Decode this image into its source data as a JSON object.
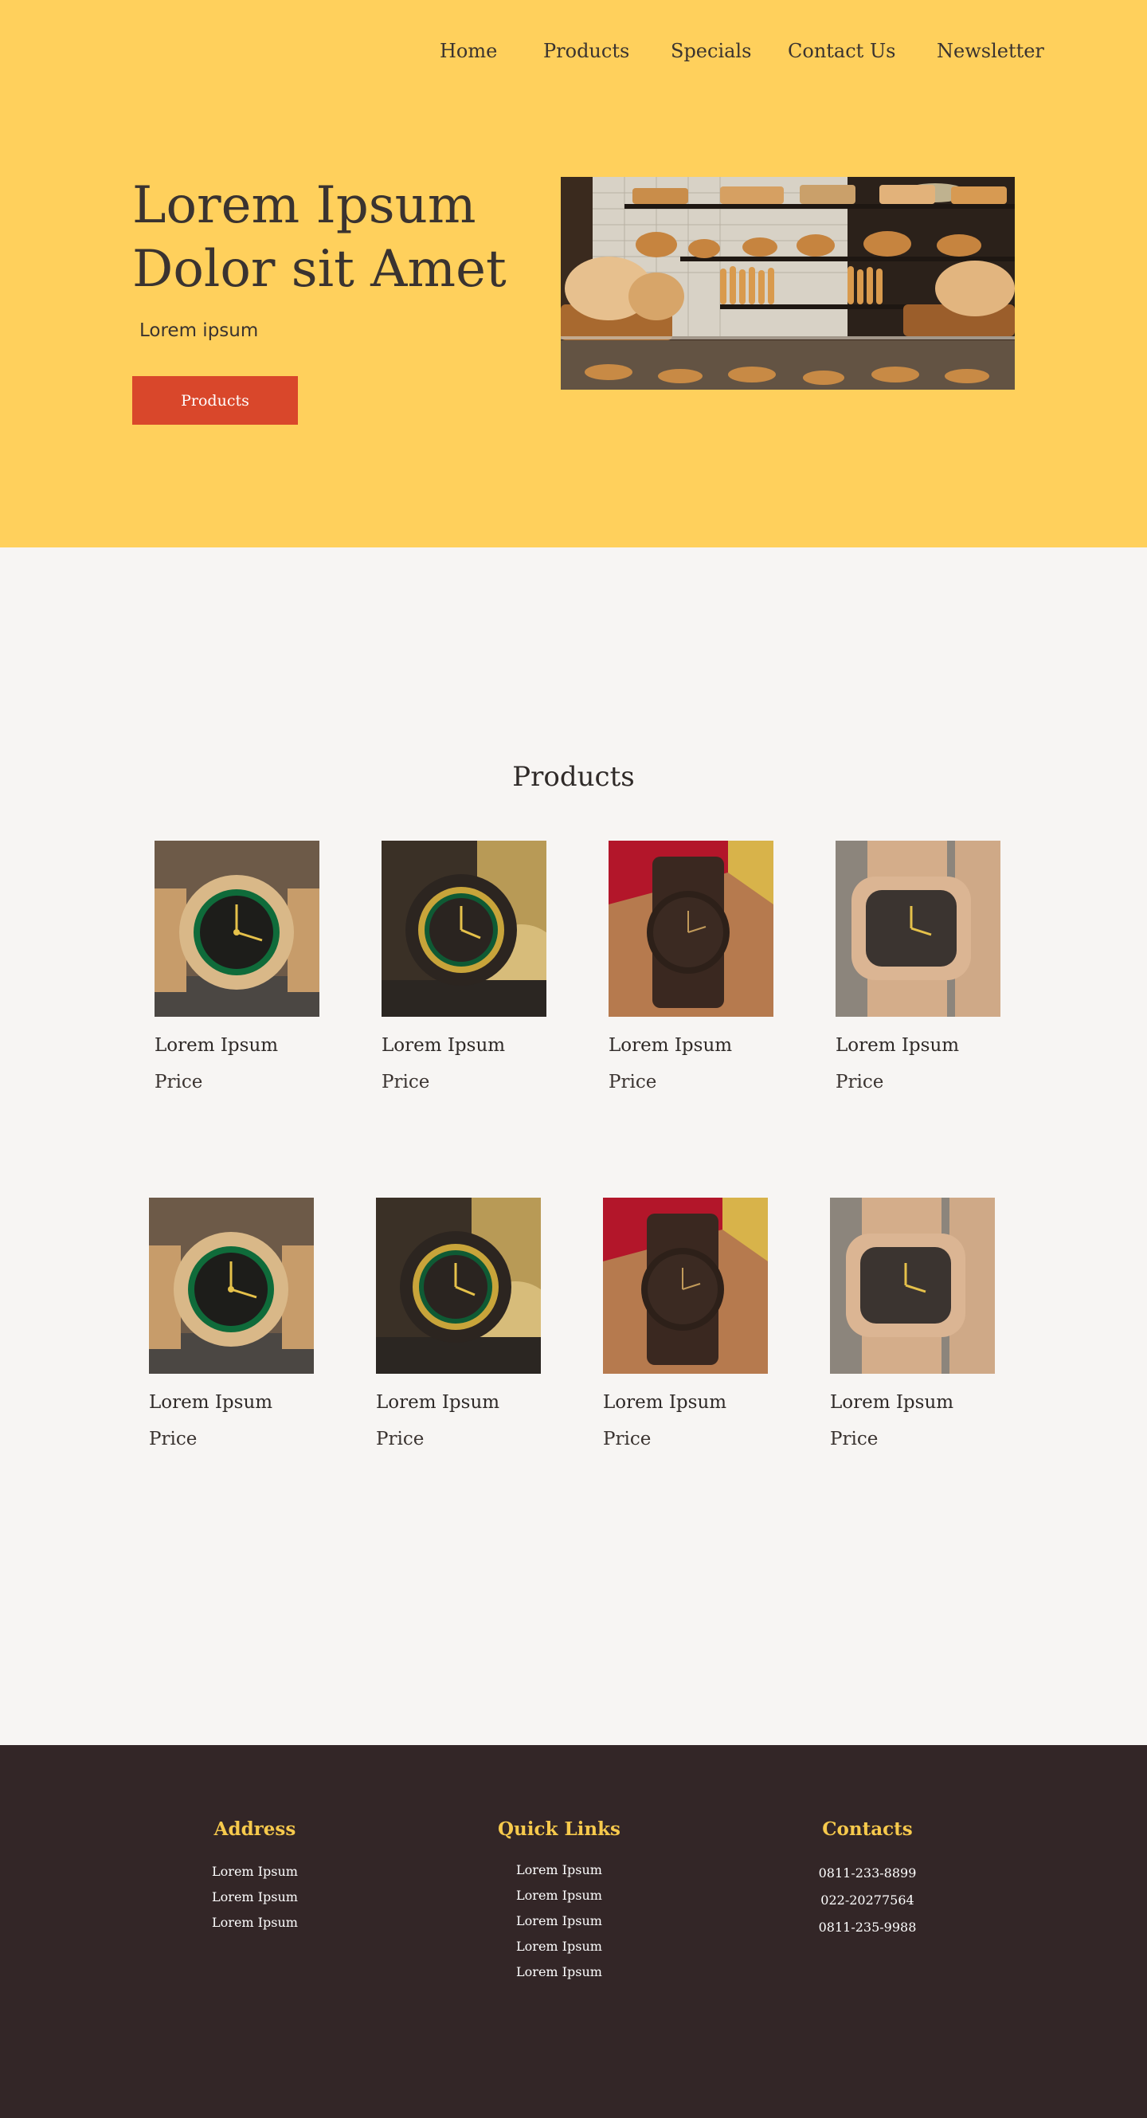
{
  "nav": {
    "items": [
      "Home",
      "Products",
      "Specials",
      "Contact Us",
      "Newsletter"
    ]
  },
  "hero": {
    "title": "Lorem Ipsum Dolor sit Amet",
    "subtitle": "Lorem ipsum",
    "button_label": "Products",
    "image": "bakery-display-shelves"
  },
  "products": {
    "heading": "Products",
    "items": [
      {
        "name": "Lorem Ipsum",
        "price": "Price",
        "image": "wood-watch-green-dial"
      },
      {
        "name": "Lorem Ipsum",
        "price": "Price",
        "image": "dark-wood-watch-gold-ring"
      },
      {
        "name": "Lorem Ipsum",
        "price": "Price",
        "image": "dark-wood-watch-on-wrist"
      },
      {
        "name": "Lorem Ipsum",
        "price": "Price",
        "image": "maple-wood-square-watch"
      },
      {
        "name": "Lorem Ipsum",
        "price": "Price",
        "image": "wood-watch-green-dial"
      },
      {
        "name": "Lorem Ipsum",
        "price": "Price",
        "image": "dark-wood-watch-gold-ring"
      },
      {
        "name": "Lorem Ipsum",
        "price": "Price",
        "image": "dark-wood-watch-on-wrist"
      },
      {
        "name": "Lorem Ipsum",
        "price": "Price",
        "image": "maple-wood-square-watch"
      }
    ]
  },
  "footer": {
    "address": {
      "heading": "Address",
      "lines": [
        "Lorem Ipsum",
        "Lorem Ipsum",
        "Lorem Ipsum"
      ]
    },
    "quick_links": {
      "heading": "Quick Links",
      "links": [
        "Lorem Ipsum",
        "Lorem Ipsum",
        "Lorem Ipsum",
        "Lorem Ipsum",
        "Lorem Ipsum"
      ]
    },
    "contacts": {
      "heading": "Contacts",
      "phones": [
        "0811-233-8899",
        "022-20277564",
        "0811-235-9988"
      ]
    }
  },
  "colors": {
    "hero_background": "#ffd05c",
    "button": "#d9472b",
    "page_background": "#f7f5f3",
    "footer_background": "#332627",
    "footer_heading": "#f6c94c"
  }
}
